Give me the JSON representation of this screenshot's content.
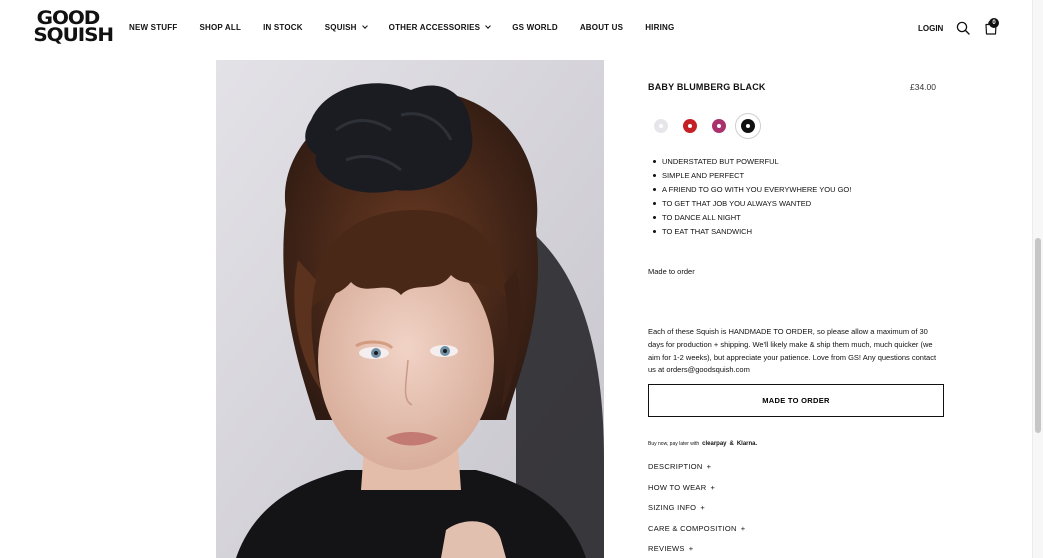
{
  "brand": {
    "logo_line1": "GOOD",
    "logo_line2": "SQUISH"
  },
  "nav": {
    "items": [
      {
        "label": "NEW STUFF",
        "dropdown": false
      },
      {
        "label": "SHOP ALL",
        "dropdown": false
      },
      {
        "label": "IN STOCK",
        "dropdown": false
      },
      {
        "label": "SQUISH",
        "dropdown": true
      },
      {
        "label": "OTHER ACCESSORIES",
        "dropdown": true
      },
      {
        "label": "GS WORLD",
        "dropdown": false
      },
      {
        "label": "ABOUT US",
        "dropdown": false
      },
      {
        "label": "HIRING",
        "dropdown": false
      }
    ],
    "login": "LOGIN",
    "cart_count": "0"
  },
  "product": {
    "title": "BABY BLUMBERG BLACK",
    "price": "£34.00",
    "swatches": [
      {
        "name": "white",
        "color": "#e6e6ea",
        "active": false
      },
      {
        "name": "red",
        "color": "#c42026",
        "active": false
      },
      {
        "name": "pink",
        "color": "#a8316e",
        "active": false
      },
      {
        "name": "black",
        "color": "#111111",
        "active": true
      }
    ],
    "bullets": [
      "UNDERSTATED BUT POWERFUL",
      "SIMPLE AND PERFECT",
      "A FRIEND TO GO WITH YOU EVERYWHERE YOU GO!",
      "TO GET THAT JOB YOU ALWAYS WANTED",
      "TO DANCE ALL NIGHT",
      "TO EAT THAT SANDWICH"
    ],
    "made_note": "Made to order",
    "description": "Each of these Squish is HANDMADE TO ORDER, so please allow a maximum of 30 days for production + shipping. We'll likely make & ship them much, much quicker (we aim for 1-2 weeks), but appreciate your patience. Love from GS! Any questions contact us at orders@goodsquish.com",
    "button_label": "MADE TO ORDER",
    "paylater": {
      "prefix": "Buy now, pay later with",
      "provider1": "clearpay",
      "joiner": "&",
      "provider2": "Klarna."
    },
    "accordion": [
      "DESCRIPTION",
      "HOW TO WEAR",
      "SIZING INFO",
      "CARE & COMPOSITION",
      "REVIEWS"
    ],
    "accordion_symbol": "+"
  }
}
